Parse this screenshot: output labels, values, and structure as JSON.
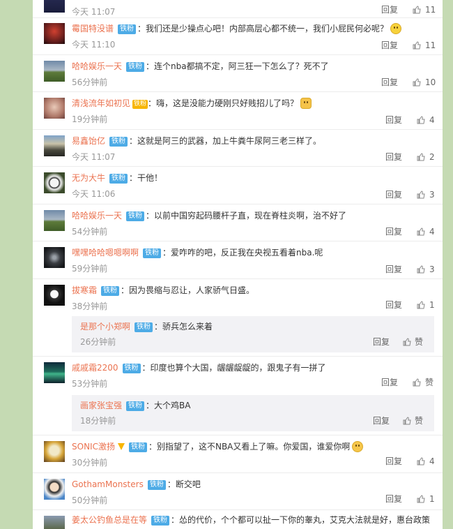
{
  "reply_label": "回复",
  "colors": {
    "name": "#eb7350",
    "badge": "#4dabe6",
    "time": "#999999",
    "page_bg": "#c5dab3"
  },
  "comments": [
    {
      "name": "",
      "badge": "",
      "text": "",
      "time": "今天 11:07",
      "reply": "回复",
      "likes": "11"
    },
    {
      "name": "霉国特没谱",
      "badge": "铁粉",
      "text": "：我们还是少操点心吧！内部高层心都不统一，我们小屁民何必呢？",
      "time": "今天 11:10",
      "reply": "回复",
      "likes": "11",
      "emoji": "smile-emoji"
    },
    {
      "name": "哈哈娱乐一天",
      "badge": "铁粉",
      "text": "：连个nba都搞不定，阿三狂一下怎么了？死不了",
      "time": "56分钟前",
      "reply": "回复",
      "likes": "10"
    },
    {
      "name": "清浅流年如初见",
      "badge": "铁粉",
      "text": "：嗨，这是没能力硬刚只好贱招儿了吗？",
      "time": "19分钟前",
      "reply": "回复",
      "likes": "4",
      "emoji": "cat-emoji",
      "vip": "铁粉"
    },
    {
      "name": "易鑫饴亿",
      "badge": "铁粉",
      "text": "：这就是阿三的武器，加上牛粪牛尿阿三老三样了。",
      "time": "今天 11:07",
      "reply": "回复",
      "likes": "2"
    },
    {
      "name": "无为大牛",
      "badge": "铁粉",
      "text": "：干他！",
      "time": "今天 11:06",
      "reply": "回复",
      "likes": "3"
    },
    {
      "name": "哈哈娱乐一天",
      "badge": "铁粉",
      "text": "：以前中国穷起码腰杆子直，现在脊柱炎啊，治不好了",
      "time": "54分钟前",
      "reply": "回复",
      "likes": "4"
    },
    {
      "name": "嘿嘿哈哈嗯嗯啊啊",
      "badge": "铁粉",
      "text": "：爱咋咋的吧，反正我在央视五看着nba.呢",
      "time": "59分钟前",
      "reply": "回复",
      "likes": "3"
    },
    {
      "name": "拔寒霜",
      "badge": "铁粉",
      "text": "：因为畏缩与忍让，人家骄气日盛。",
      "time": "38分钟前",
      "reply": "回复",
      "likes": "1",
      "sub": {
        "name": "是那个小郑啊",
        "badge": "铁粉",
        "text": "：骄兵怎么来着",
        "time": "26分钟前",
        "reply": "回复",
        "likes": "赞"
      }
    },
    {
      "name": "戚戚霜2200",
      "badge": "铁粉",
      "text": "：印度也算个大国，龌龌龊龊的，跟鬼子有一拼了",
      "time": "53分钟前",
      "reply": "回复",
      "likes": "赞",
      "sub": {
        "name": "画家张宝强",
        "badge": "铁粉",
        "text": "：大个鸡BA",
        "time": "18分钟前",
        "reply": "回复",
        "likes": "赞"
      }
    },
    {
      "name": "SONIC激扬",
      "badge": "铁粉",
      "text": "：别指望了，这不NBA又看上了嘛。你爱国，谁爱你啊",
      "time": "30分钟前",
      "reply": "回复",
      "likes": "4",
      "emoji": "laugh-emoji",
      "vv": "true"
    },
    {
      "name": "GothamMonsters",
      "badge": "铁粉",
      "text": "：断交吧",
      "time": "50分钟前",
      "reply": "回复",
      "likes": "1"
    },
    {
      "name": "姜太公钓鱼总是在等",
      "badge": "铁粉",
      "text": "：怂的代价，个个都可以扯一下你的睾丸，艾克大法就是好，惠台政策",
      "time": "",
      "reply": "",
      "likes": ""
    }
  ]
}
